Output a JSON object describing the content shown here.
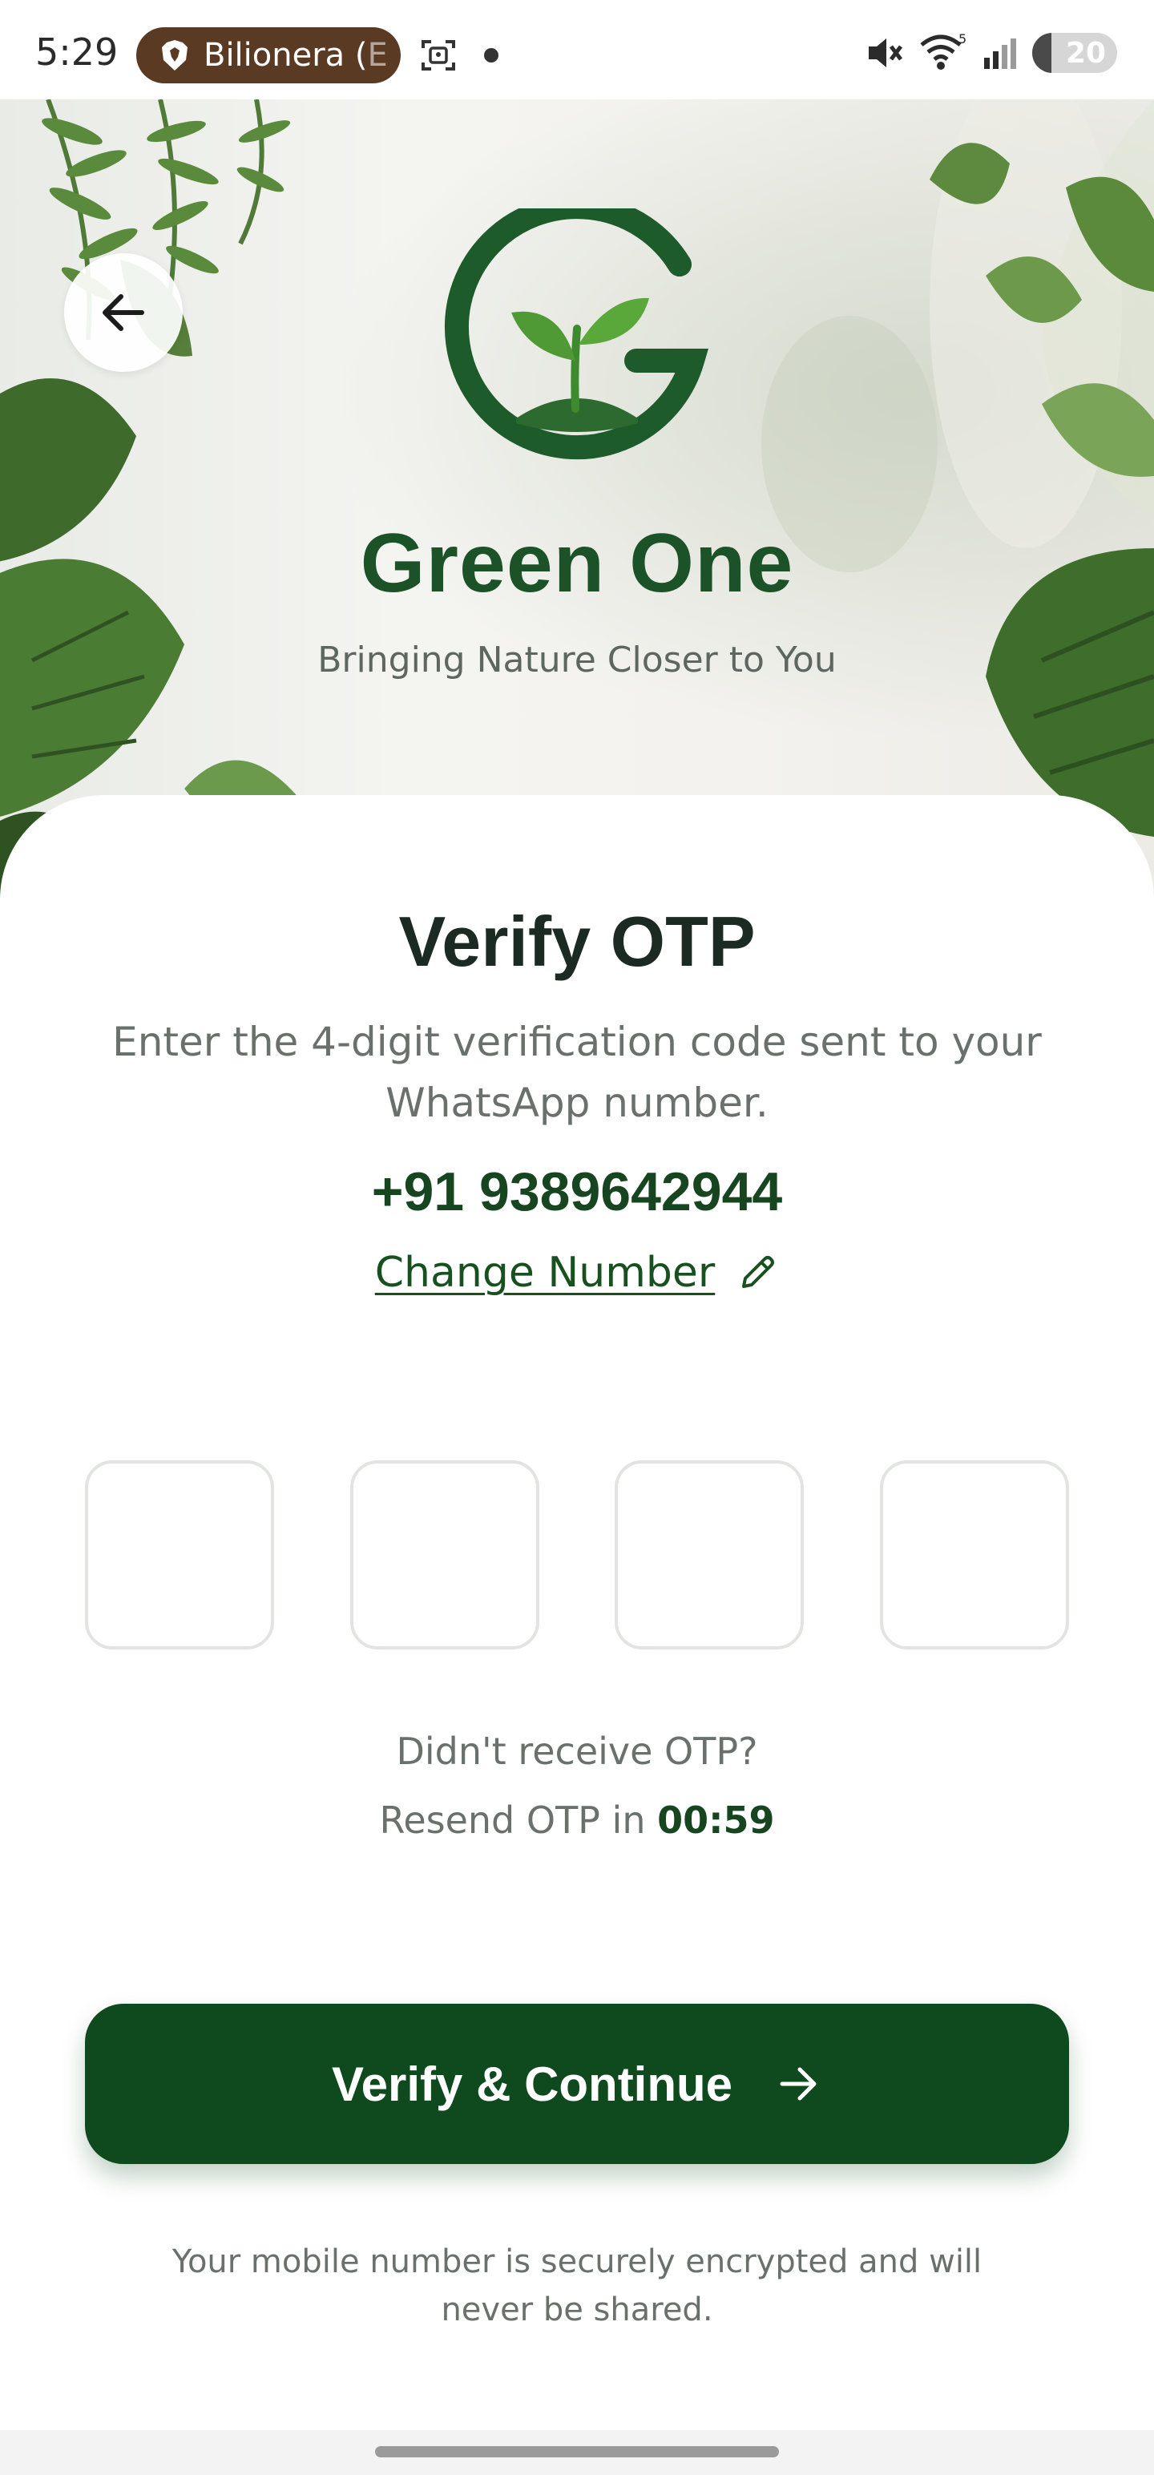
{
  "status_bar": {
    "time": "5:29",
    "pill_app": "Bilionera (",
    "pill_app_faded": "E",
    "battery": "20",
    "icons": [
      "brave-browser-icon",
      "screenshot-icon",
      "notification-dot",
      "mute-icon",
      "wifi-icon",
      "signal-icon",
      "battery-icon"
    ]
  },
  "header": {
    "back_icon": "arrow-left-icon",
    "brand_name": "Green One",
    "tagline": "Bringing Nature Closer to You"
  },
  "verify": {
    "title": "Verify OTP",
    "description": "Enter the 4-digit verification code sent to your WhatsApp number.",
    "phone_number": "+91 9389642944",
    "change_number_label": "Change Number",
    "change_icon": "pencil-icon"
  },
  "otp": {
    "digits": [
      "",
      "",
      "",
      ""
    ]
  },
  "resend": {
    "question": "Didn't receive OTP?",
    "prefix": "Resend OTP in",
    "timer": "00:59"
  },
  "cta": {
    "label": "Verify & Continue",
    "icon": "arrow-right-icon"
  },
  "footer": {
    "secure_note": "Your mobile number is securely encrypted and will never be shared."
  },
  "colors": {
    "brand_green": "#0f4a1e",
    "title_green": "#1c5227",
    "text_muted": "#6a716c"
  }
}
